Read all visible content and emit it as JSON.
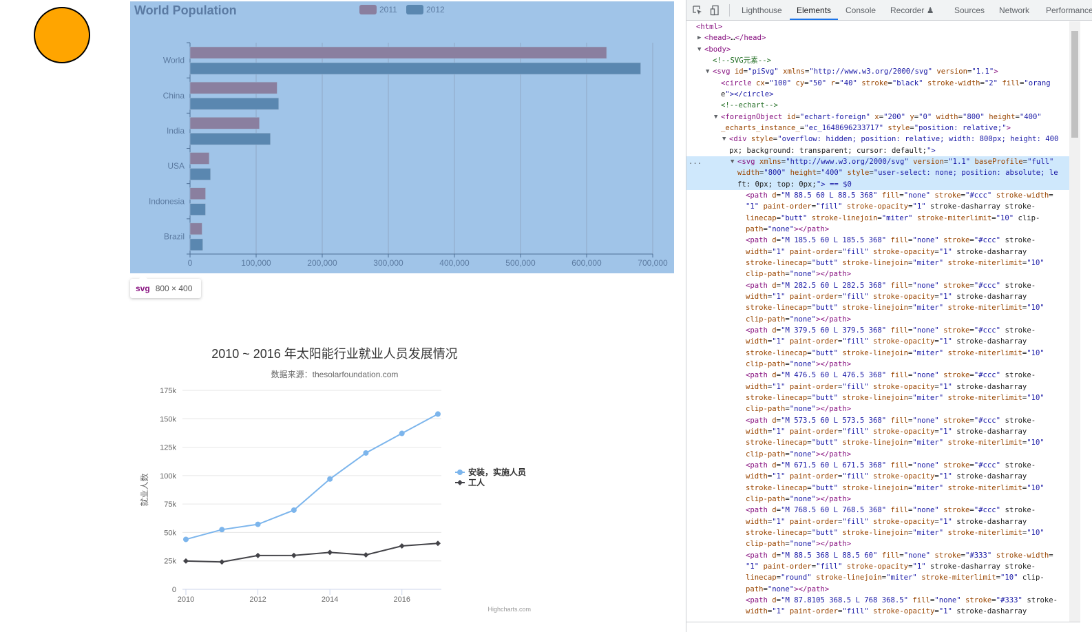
{
  "circle": {
    "fill": "#FFA500",
    "stroke": "#000000"
  },
  "echart": {
    "background": "#a0c4e8",
    "chart_data": {
      "type": "bar",
      "orientation": "horizontal",
      "title": "World Population",
      "categories": [
        "Brazil",
        "Indonesia",
        "USA",
        "India",
        "China",
        "World"
      ],
      "series": [
        {
          "name": "2011",
          "color": "#8a7f9f",
          "values": [
            18203,
            23489,
            29034,
            104970,
            131744,
            630230
          ]
        },
        {
          "name": "2012",
          "color": "#5a87b0",
          "values": [
            19325,
            23438,
            31000,
            121594,
            134141,
            681807
          ]
        }
      ],
      "xlim": [
        0,
        700000
      ],
      "xticks": [
        "0",
        "100,000",
        "200,000",
        "300,000",
        "400,000",
        "500,000",
        "600,000",
        "700,000"
      ],
      "grid": true,
      "legend": "top-center"
    }
  },
  "tooltip": {
    "tag": "svg",
    "size": "800 × 400"
  },
  "highcharts": {
    "chart_data": {
      "type": "line",
      "title": "2010 ~ 2016 年太阳能行业就业人员发展情况",
      "subtitle": "数据来源：thesolarfoundation.com",
      "ylabel": "就业人数",
      "x": [
        2010,
        2011,
        2012,
        2013,
        2014,
        2015,
        2016,
        2017
      ],
      "xticks": [
        "2010",
        "2012",
        "2014",
        "2016"
      ],
      "yticks": [
        "0",
        "25k",
        "50k",
        "75k",
        "100k",
        "125k",
        "150k",
        "175k"
      ],
      "ylim": [
        0,
        175000
      ],
      "series": [
        {
          "name": "安装，实施人员",
          "color": "#7cb5ec",
          "marker": "circle",
          "values": [
            43934,
            52503,
            57177,
            69658,
            97031,
            119931,
            137133,
            154175
          ]
        },
        {
          "name": "工人",
          "color": "#434348",
          "marker": "diamond",
          "values": [
            24916,
            24064,
            29742,
            29851,
            32490,
            30282,
            38121,
            40434
          ]
        }
      ],
      "grid": true,
      "legend": "right",
      "credits": "Highcharts.com"
    }
  },
  "devtools": {
    "tabs": [
      {
        "label": "Lighthouse",
        "active": false
      },
      {
        "label": "Elements",
        "active": true
      },
      {
        "label": "Console",
        "active": false
      },
      {
        "label": "Recorder ♟",
        "active": false
      },
      {
        "label": "Sources",
        "active": false
      },
      {
        "label": "Network",
        "active": false
      },
      {
        "label": "Performance",
        "active": false
      }
    ],
    "selected_marker": "...",
    "lines": [
      "<html>",
      "<head>…</head>",
      "<body>",
      "<!--SVG元素-->",
      "<svg id=\"piSvg\" xmlns=\"http://www.w3.org/2000/svg\" version=\"1.1\">",
      "<circle cx=\"100\" cy=\"50\" r=\"40\" stroke=\"black\" stroke-width=\"2\" fill=\"orang",
      "e\"></circle>",
      "<!--echart-->",
      "<foreignObject id=\"echart-foreign\" x=\"200\" y=\"0\" width=\"800\" height=\"400\"",
      "_echarts_instance_=\"ec_1648696233717\" style=\"position: relative;\">",
      "<div style=\"overflow: hidden; position: relative; width: 800px; height: 400",
      "px; background: transparent; cursor: default;\">",
      "<svg xmlns=\"http://www.w3.org/2000/svg\" version=\"1.1\" baseProfile=\"full\"",
      "width=\"800\" height=\"400\" style=\"user-select: none; position: absolute; le",
      "ft: 0px; top: 0px;\"> == $0",
      "<path d=\"M 88.5 60 L 88.5 368\" fill=\"none\" stroke=\"#ccc\" stroke-width=",
      "\"1\" paint-order=\"fill\" stroke-opacity=\"1\" stroke-dasharray stroke-",
      "linecap=\"butt\" stroke-linejoin=\"miter\" stroke-miterlimit=\"10\" clip-",
      "path=\"none\"></path>",
      "<path d=\"M 185.5 60 L 185.5 368\" fill=\"none\" stroke=\"#ccc\" stroke-",
      "width=\"1\" paint-order=\"fill\" stroke-opacity=\"1\" stroke-dasharray",
      "stroke-linecap=\"butt\" stroke-linejoin=\"miter\" stroke-miterlimit=\"10\"",
      "clip-path=\"none\"></path>",
      "<path d=\"M 282.5 60 L 282.5 368\" fill=\"none\" stroke=\"#ccc\" stroke-",
      "width=\"1\" paint-order=\"fill\" stroke-opacity=\"1\" stroke-dasharray",
      "stroke-linecap=\"butt\" stroke-linejoin=\"miter\" stroke-miterlimit=\"10\"",
      "clip-path=\"none\"></path>",
      "<path d=\"M 379.5 60 L 379.5 368\" fill=\"none\" stroke=\"#ccc\" stroke-",
      "width=\"1\" paint-order=\"fill\" stroke-opacity=\"1\" stroke-dasharray",
      "stroke-linecap=\"butt\" stroke-linejoin=\"miter\" stroke-miterlimit=\"10\"",
      "clip-path=\"none\"></path>",
      "<path d=\"M 476.5 60 L 476.5 368\" fill=\"none\" stroke=\"#ccc\" stroke-",
      "width=\"1\" paint-order=\"fill\" stroke-opacity=\"1\" stroke-dasharray",
      "stroke-linecap=\"butt\" stroke-linejoin=\"miter\" stroke-miterlimit=\"10\"",
      "clip-path=\"none\"></path>",
      "<path d=\"M 573.5 60 L 573.5 368\" fill=\"none\" stroke=\"#ccc\" stroke-",
      "width=\"1\" paint-order=\"fill\" stroke-opacity=\"1\" stroke-dasharray",
      "stroke-linecap=\"butt\" stroke-linejoin=\"miter\" stroke-miterlimit=\"10\"",
      "clip-path=\"none\"></path>",
      "<path d=\"M 671.5 60 L 671.5 368\" fill=\"none\" stroke=\"#ccc\" stroke-",
      "width=\"1\" paint-order=\"fill\" stroke-opacity=\"1\" stroke-dasharray",
      "stroke-linecap=\"butt\" stroke-linejoin=\"miter\" stroke-miterlimit=\"10\"",
      "clip-path=\"none\"></path>",
      "<path d=\"M 768.5 60 L 768.5 368\" fill=\"none\" stroke=\"#ccc\" stroke-",
      "width=\"1\" paint-order=\"fill\" stroke-opacity=\"1\" stroke-dasharray",
      "stroke-linecap=\"butt\" stroke-linejoin=\"miter\" stroke-miterlimit=\"10\"",
      "clip-path=\"none\"></path>",
      "<path d=\"M 88.5 368 L 88.5 60\" fill=\"none\" stroke=\"#333\" stroke-width=",
      "\"1\" paint-order=\"fill\" stroke-opacity=\"1\" stroke-dasharray stroke-",
      "linecap=\"round\" stroke-linejoin=\"miter\" stroke-miterlimit=\"10\" clip-",
      "path=\"none\"></path>",
      "<path d=\"M 87.8105 368.5 L 768 368.5\" fill=\"none\" stroke=\"#333\" stroke-",
      "width=\"1\" paint-order=\"fill\" stroke-opacity=\"1\" stroke-dasharray"
    ]
  }
}
